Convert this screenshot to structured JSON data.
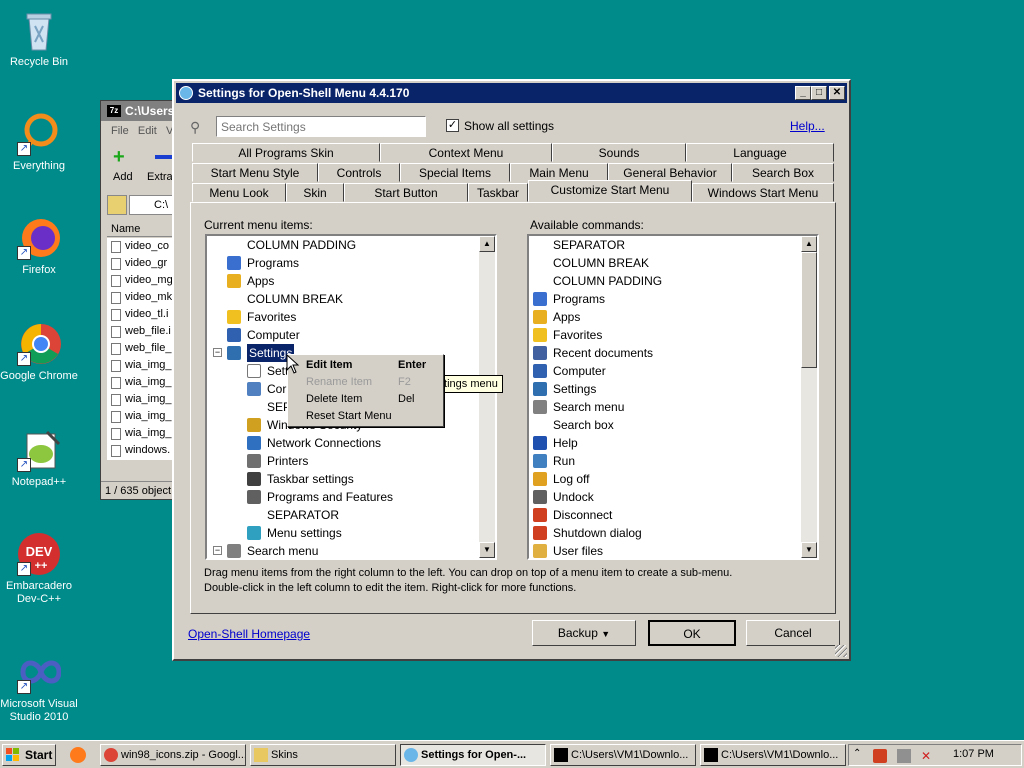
{
  "desktop": {
    "icons": [
      {
        "label": "Recycle Bin"
      },
      {
        "label": "Everything"
      },
      {
        "label": "Firefox"
      },
      {
        "label": "Google Chrome"
      },
      {
        "label": "Notepad++"
      },
      {
        "label": "Embarcadero Dev-C++"
      },
      {
        "label": "Microsoft Visual Studio 2010"
      }
    ]
  },
  "back_window": {
    "title": "C:\\Users",
    "menu": [
      "File",
      "Edit",
      "V"
    ],
    "toolbar": {
      "add": "Add",
      "extract": "Extra"
    },
    "path": "C:\\",
    "column": "Name",
    "files": [
      "video_co",
      "video_gr",
      "video_mg",
      "video_mk",
      "video_tl.i",
      "web_file.i",
      "web_file_",
      "wia_img_",
      "wia_img_",
      "wia_img_",
      "wia_img_",
      "wia_img_",
      "windows."
    ],
    "status": "1 / 635 object"
  },
  "window": {
    "title": "Settings for Open-Shell Menu 4.4.170",
    "search_placeholder": "Search Settings",
    "show_all": "Show all settings",
    "help": "Help...",
    "tabs_row1": [
      "All Programs Skin",
      "Context Menu",
      "Sounds",
      "Language"
    ],
    "tabs_row2": [
      "Start Menu Style",
      "Controls",
      "Special Items",
      "Main Menu",
      "General Behavior",
      "Search Box"
    ],
    "tabs_row3": [
      "Menu Look",
      "Skin",
      "Start Button",
      "Taskbar",
      "Customize Start Menu",
      "Windows Start Menu"
    ],
    "left_label": "Current menu items:",
    "right_label": "Available commands:",
    "left_items": [
      {
        "text": "COLUMN PADDING",
        "icon": ""
      },
      {
        "text": "Programs",
        "icon": "#3a6fd0"
      },
      {
        "text": "Apps",
        "icon": "#e8b020"
      },
      {
        "text": "COLUMN BREAK",
        "icon": ""
      },
      {
        "text": "Favorites",
        "icon": "#f0c020"
      },
      {
        "text": "Computer",
        "icon": "#3060b0"
      },
      {
        "text": "Settings",
        "icon": "#2f6fb0"
      },
      {
        "text": "Sett",
        "icon": "#ffffff"
      },
      {
        "text": "Cor",
        "icon": "#5080c0"
      },
      {
        "text": "SEP",
        "icon": ""
      },
      {
        "text": "Windows Security",
        "icon": "#d0a020"
      },
      {
        "text": "Network Connections",
        "icon": "#3070c0"
      },
      {
        "text": "Printers",
        "icon": "#707070"
      },
      {
        "text": "Taskbar settings",
        "icon": "#404040"
      },
      {
        "text": "Programs and Features",
        "icon": "#606060"
      },
      {
        "text": "SEPARATOR",
        "icon": ""
      },
      {
        "text": "Menu settings",
        "icon": "#30a0c0"
      },
      {
        "text": "Search menu",
        "icon": "#808080"
      }
    ],
    "right_items": [
      {
        "text": "SEPARATOR",
        "icon": ""
      },
      {
        "text": "COLUMN BREAK",
        "icon": ""
      },
      {
        "text": "COLUMN PADDING",
        "icon": ""
      },
      {
        "text": "Programs",
        "icon": "#3a6fd0"
      },
      {
        "text": "Apps",
        "icon": "#e8b020"
      },
      {
        "text": "Favorites",
        "icon": "#f0c020"
      },
      {
        "text": "Recent documents",
        "icon": "#4060a0"
      },
      {
        "text": "Computer",
        "icon": "#3060b0"
      },
      {
        "text": "Settings",
        "icon": "#2f6fb0"
      },
      {
        "text": "Search menu",
        "icon": "#808080"
      },
      {
        "text": "Search box",
        "icon": ""
      },
      {
        "text": "Help",
        "icon": "#2050b0"
      },
      {
        "text": "Run",
        "icon": "#4080c0"
      },
      {
        "text": "Log off",
        "icon": "#e0a020"
      },
      {
        "text": "Undock",
        "icon": "#606060"
      },
      {
        "text": "Disconnect",
        "icon": "#d04020"
      },
      {
        "text": "Shutdown dialog",
        "icon": "#d04020"
      },
      {
        "text": "User files",
        "icon": "#e0b040"
      }
    ],
    "tooltip": "ttings menu",
    "hint_line1": "Drag menu items from the right column to the left. You can drop on top of a menu item to create a sub-menu.",
    "hint_line2": "Double-click in the left column to edit the item. Right-click for more functions.",
    "homepage": "Open-Shell Homepage",
    "backup": "Backup",
    "ok": "OK",
    "cancel": "Cancel"
  },
  "context_menu": {
    "items": [
      {
        "label": "Edit Item",
        "key": "Enter"
      },
      {
        "label": "Rename Item",
        "key": "F2"
      },
      {
        "label": "Delete Item",
        "key": "Del"
      },
      {
        "label": "Reset Start Menu",
        "key": ""
      }
    ]
  },
  "taskbar": {
    "start": "Start",
    "items": [
      "win98_icons.zip - Googl...",
      "Skins",
      "Settings for Open-...",
      "C:\\Users\\VM1\\Downlo...",
      "C:\\Users\\VM1\\Downlo..."
    ],
    "clock": "1:07 PM"
  }
}
